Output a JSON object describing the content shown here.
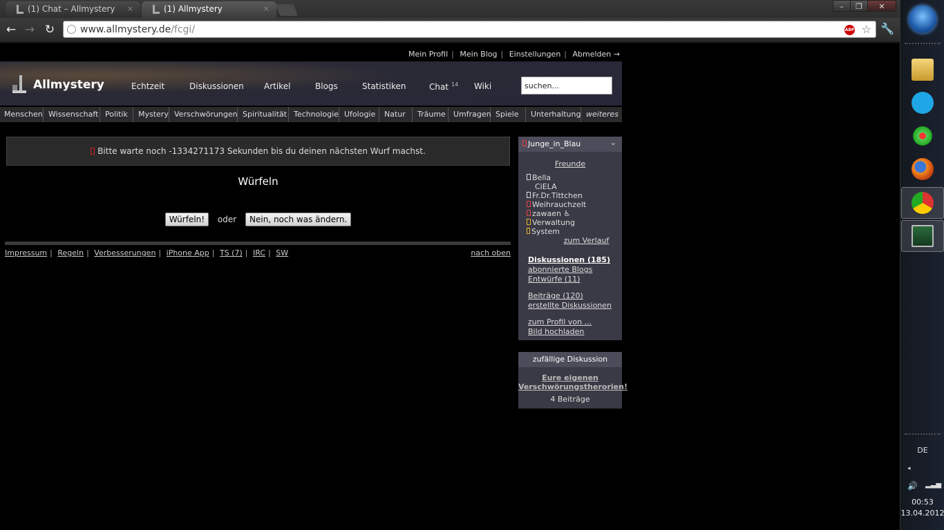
{
  "browser": {
    "tabs": [
      {
        "label": "(1) Chat – Allmystery",
        "active": false
      },
      {
        "label": "(1) Allmystery",
        "active": true
      }
    ],
    "tab_close": "×",
    "window_controls": {
      "minimize": "–",
      "maximize": "❐",
      "close": "✕"
    },
    "nav": {
      "back": "←",
      "forward": "→",
      "reload": "↻"
    },
    "url_host": "www.allmystery.de",
    "url_path": "/fcgi/",
    "abp_label": "ABP",
    "star": "☆",
    "wrench": "🔧"
  },
  "topnav": [
    "Mein Profil",
    "Mein Blog",
    "Einstellungen",
    "Abmelden →"
  ],
  "logo": {
    "name": "Allmystery"
  },
  "mainnav": [
    {
      "label": "Echtzeit"
    },
    {
      "label": "Diskussionen"
    },
    {
      "label": "Artikel"
    },
    {
      "label": "Blogs"
    },
    {
      "label": "Statistiken"
    },
    {
      "label": "Chat",
      "badge": "14"
    },
    {
      "label": "Wiki"
    }
  ],
  "search": {
    "value": "suchen..."
  },
  "categories": [
    "Menschen",
    "Wissenschaft",
    "Politik",
    "Mystery",
    "Verschwörungen",
    "Spiritualität",
    "Technologie",
    "Ufologie",
    "Natur",
    "Träume",
    "Umfragen",
    "Spiele",
    "Unterhaltung",
    "weiteres"
  ],
  "notice": "Bitte warte noch -1334271173 Sekunden bis du deinen nächsten Wurf machst.",
  "dice": {
    "title": "Würfeln",
    "roll_button": "Würfeln!",
    "or": "oder",
    "change_button": "Nein, noch was ändern."
  },
  "footer": {
    "links": [
      "Impressum",
      "Regeln",
      "Verbesserungen",
      "iPhone App",
      "TS (7)",
      "IRC",
      "SW"
    ],
    "top": "nach oben"
  },
  "sidebar": {
    "user": "Junge_in_Blau",
    "chevron": "⌄",
    "friends_heading": "Freunde",
    "friends": [
      {
        "name": "Bella",
        "icon": "white"
      },
      {
        "name": "CiELA",
        "icon": "none"
      },
      {
        "name": "Fr.Dr.Tittchen",
        "icon": "white"
      },
      {
        "name": "Weihrauchzelt",
        "icon": "red"
      },
      {
        "name": "zawaen",
        "icon": "red",
        "extra": "♿"
      },
      {
        "name": "Verwaltung",
        "icon": "yellow"
      },
      {
        "name": "System",
        "icon": "box"
      }
    ],
    "history_link": "zum Verlauf",
    "links_group1": [
      "Diskussionen (185)",
      "abonnierte Blogs",
      "Entwürfe (11)"
    ],
    "links_group2": [
      "Beiträge (120)",
      "erstellte Diskussionen"
    ],
    "links_group3": [
      "zum Profil von ...",
      "Bild hochladen"
    ]
  },
  "random": {
    "heading": "zufällige Diskussion",
    "title": "Eure eigenen Verschwörungstherorien!",
    "count": "4 Beiträge"
  },
  "taskbar": {
    "lang": "DE",
    "time": "00:53",
    "date": "13.04.2012",
    "tray_arrow": "◂",
    "volume": "🔊",
    "network": "▂▃▅"
  },
  "colors": {
    "accent": "#3a3a46",
    "header": "#262638",
    "warn": "#cc2222"
  }
}
